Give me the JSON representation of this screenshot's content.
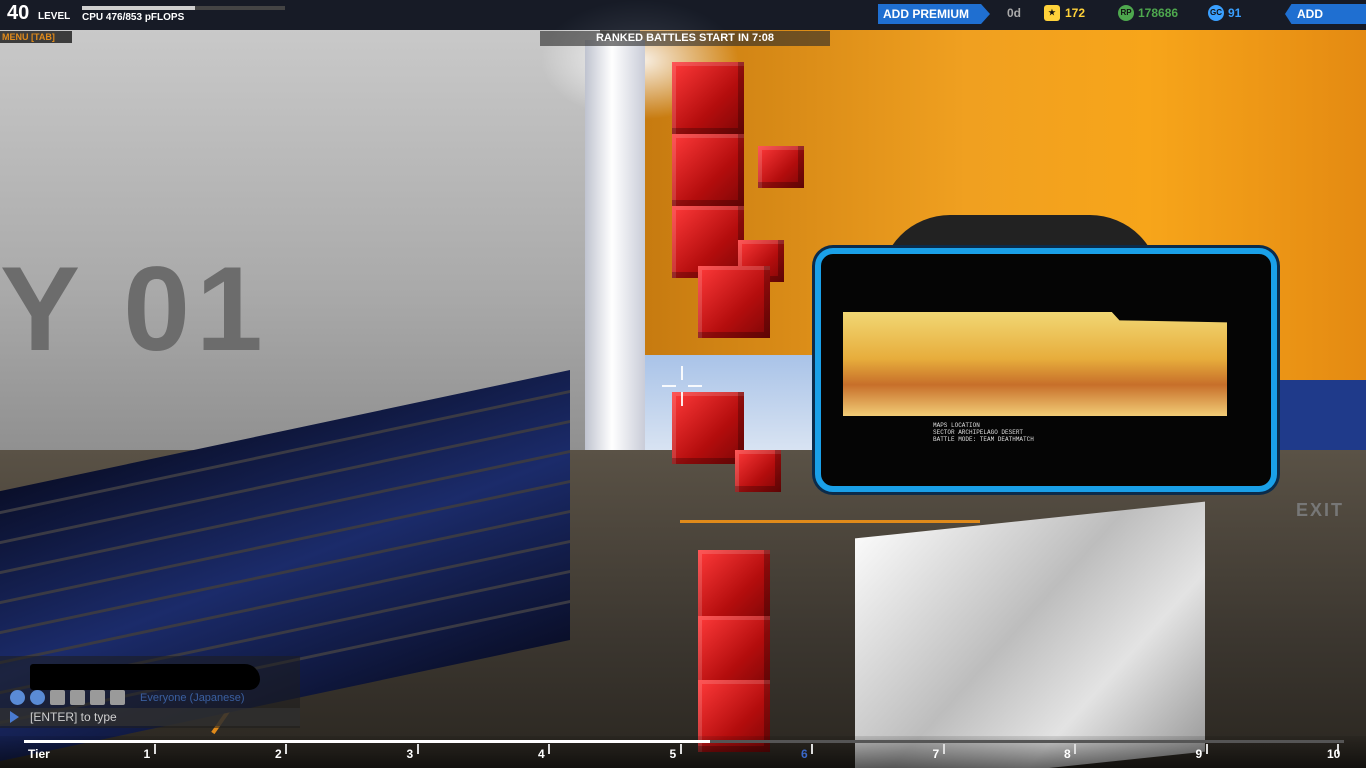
{
  "hud": {
    "level_number": "40",
    "level_label": "LEVEL",
    "cpu_text": "CPU 476/853 pFLOPS",
    "cpu_used": 476,
    "cpu_max": 853,
    "add_premium_label": "ADD PREMIUM",
    "premium_days": "0d",
    "stars": "172",
    "robit_points": "178686",
    "galaxy_cosmetic": "91",
    "add_funds_label": "ADD FUNDS",
    "menu_tab_label": "MENU [TAB]",
    "ranked_banner": "RANKED BATTLES START IN 7:08",
    "colors": {
      "accent_blue": "#1f6fd1",
      "star_gold": "#ffd23a",
      "rp_green": "#4ea84e",
      "gc_blue": "#3aa0ff"
    }
  },
  "scene": {
    "wall_text": "Y 01",
    "exit_label": "EXIT",
    "monitor_text": "MAPS LOCATION\nSECTOR ARCHIPELAGO DESERT\nBATTLE MODE: TEAM DEATHMATCH"
  },
  "chat": {
    "channel_label": "Everyone (Japanese)",
    "input_placeholder": "[ENTER] to type",
    "icons": [
      "globe-icon",
      "person-icon",
      "party-icon",
      "user1-icon",
      "user2-icon",
      "user3-icon"
    ]
  },
  "tier_bar": {
    "label": "Tier",
    "tiers": [
      "1",
      "2",
      "3",
      "4",
      "5",
      "6",
      "7",
      "8",
      "9",
      "10"
    ],
    "current_tier": "6",
    "progress_fraction": 0.52
  }
}
